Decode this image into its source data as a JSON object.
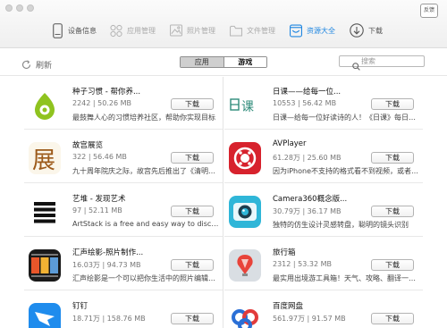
{
  "titlebar": {
    "feedback_label": "反馈"
  },
  "nav": [
    {
      "label": "设备信息",
      "icon": "device-icon"
    },
    {
      "label": "应用管理",
      "icon": "apps-grid-icon"
    },
    {
      "label": "照片管理",
      "icon": "photo-icon"
    },
    {
      "label": "文件管理",
      "icon": "folder-icon"
    },
    {
      "label": "资源大全",
      "icon": "resource-store-icon"
    },
    {
      "label": "下载",
      "icon": "download-circle-icon"
    }
  ],
  "toolbar": {
    "refresh_label": "刷新",
    "tab_apps": "应用",
    "tab_games": "游戏",
    "search_placeholder": "搜索"
  },
  "download_label": "下载",
  "apps": [
    {
      "name": "种子习惯 - 帮你养...",
      "meta": "2242 | 50.26 MB",
      "desc": "最鼓舞人心的习惯培养社区，帮助你实现目标",
      "icon": "seed-habit-icon"
    },
    {
      "name": "日课——给每一位...",
      "meta": "10553 | 56.42 MB",
      "desc": "日课—给每一位好读诗的人！《日课》每日一首",
      "icon": "rike-icon"
    },
    {
      "name": "故宫展览",
      "meta": "322 | 56.46 MB",
      "desc": "九十周年院庆之际，故宫先后推出了《清明上河图》",
      "icon": "palace-exhibit-icon"
    },
    {
      "name": "AVPlayer",
      "meta": "61.28万 | 25.60 MB",
      "desc": "因为iPhone不支持的格式看不到视频，或者说更多",
      "icon": "avplayer-icon"
    },
    {
      "name": "艺堆 - 发现艺术",
      "meta": "97 | 52.11 MB",
      "desc": "ArtStack is a free and easy way to discover art",
      "icon": "artstack-icon"
    },
    {
      "name": "Camera360概念版...",
      "meta": "30.79万 | 36.17 MB",
      "desc": "独特的仿生设计灵感转盘，聪明的镜头识别",
      "icon": "camera360-icon"
    },
    {
      "name": "汇声绘影-照片制作...",
      "meta": "16.03万 | 94.73 MB",
      "desc": "汇声绘影是一个可以把你生活中的照片编辑成视频",
      "icon": "video-maker-icon"
    },
    {
      "name": "旅行箱",
      "meta": "2312 | 53.32 MB",
      "desc": "最实用出境游工具箱！天气、攻略、翻译一应俱全",
      "icon": "travel-box-icon"
    },
    {
      "name": "钉钉",
      "meta": "18.71万 | 158.76 MB",
      "desc": "",
      "icon": "dingtalk-icon"
    },
    {
      "name": "百度网盘",
      "meta": "561.97万 | 91.57 MB",
      "desc": "",
      "icon": "baidu-netdisk-icon"
    }
  ]
}
